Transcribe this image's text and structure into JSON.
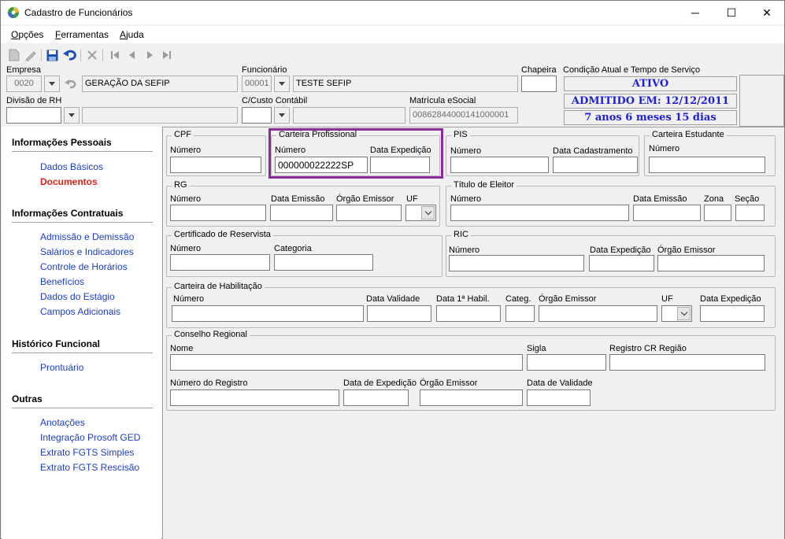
{
  "window": {
    "title": "Cadastro de Funcionários",
    "minimize": "─",
    "maximize": "☐",
    "close": "✕"
  },
  "menu": [
    {
      "label": "Opções",
      "mnemonic": "O",
      "rest": "pções"
    },
    {
      "label": "Ferramentas",
      "mnemonic": "F",
      "rest": "erramentas"
    },
    {
      "label": "Ajuda",
      "mnemonic": "A",
      "rest": "juda"
    }
  ],
  "toolbar": {
    "icons": [
      "new-icon",
      "edit-icon",
      "save-icon",
      "undo-icon",
      "delete-icon",
      "first-icon",
      "prev-icon",
      "next-icon",
      "last-icon"
    ]
  },
  "header": {
    "empresa_label": "Empresa",
    "empresa_code": "0020",
    "empresa_name": "GERAÇÃO DA SEFIP",
    "funcionario_label": "Funcionário",
    "funcionario_code": "00001",
    "funcionario_name": "TESTE SEFIP",
    "chapeira_label": "Chapeira",
    "chapeira_value": "",
    "condicao_label": "Condição Atual e Tempo de Serviço",
    "status_ativo": "ATIVO",
    "status_admitido": "ADMITIDO EM: 12/12/2011",
    "status_tempo": "7 anos 6 meses 15 dias",
    "divisao_label": "Divisão de RH",
    "divisao_value": "",
    "divisao_name": "",
    "custo_label": "C/Custo Contábil",
    "custo_value": "",
    "custo_name": "",
    "matricula_label": "Matrícula eSocial",
    "matricula_value": "00862844000141000001"
  },
  "sidebar": {
    "sections": [
      {
        "title": "Informações Pessoais",
        "items": [
          "Dados Básicos",
          "Documentos"
        ]
      },
      {
        "title": "Informações Contratuais",
        "items": [
          "Admissão e Demissão",
          "Salários e Indicadores",
          "Controle de Horários",
          "Benefícios",
          "Dados do Estágio",
          "Campos Adicionais"
        ]
      },
      {
        "title": "Histórico Funcional",
        "items": [
          "Prontuário"
        ]
      },
      {
        "title": "Outras",
        "items": [
          "Anotações",
          "Integração Prosoft GED",
          "Extrato FGTS Simples",
          "Extrato FGTS Rescisão"
        ]
      }
    ],
    "active_item": "Documentos"
  },
  "documents": {
    "cpf": {
      "title": "CPF",
      "numero_label": "Número",
      "numero": ""
    },
    "ctps": {
      "title": "Carteira Profissional",
      "numero_label": "Número",
      "numero": "000000022222SP",
      "data_label": "Data Expedição",
      "data": ""
    },
    "pis": {
      "title": "PIS",
      "numero_label": "Número",
      "numero": "",
      "data_label": "Data Cadastramento",
      "data": ""
    },
    "estudante": {
      "title": "Carteira Estudante",
      "numero_label": "Número",
      "numero": ""
    },
    "rg": {
      "title": "RG",
      "numero_label": "Número",
      "emissao_label": "Data Emissão",
      "orgao_label": "Órgão Emissor",
      "uf_label": "UF"
    },
    "titulo": {
      "title": "Título de Eleitor",
      "numero_label": "Número",
      "emissao_label": "Data Emissão",
      "zona_label": "Zona",
      "secao_label": "Seção"
    },
    "reservista": {
      "title": "Certificado de Reservista",
      "numero_label": "Número",
      "categoria_label": "Categoria"
    },
    "ric": {
      "title": "RIC",
      "numero_label": "Número",
      "expedicao_label": "Data Expedição",
      "orgao_label": "Órgão Emissor"
    },
    "cnh": {
      "title": "Carteira de Habilitação",
      "numero_label": "Número",
      "validade_label": "Data Validade",
      "habil_label": "Data 1ª Habil.",
      "categ_label": "Categ.",
      "orgao_label": "Órgão Emissor",
      "uf_label": "UF",
      "expedicao_label": "Data Expedição"
    },
    "conselho": {
      "title": "Conselho Regional",
      "nome_label": "Nome",
      "sigla_label": "Sigla",
      "regiao_label": "Registro CR Região",
      "registro_label": "Número do Registro",
      "expedicao_label": "Data de Expedição",
      "orgao_label": "Órgão Emissor",
      "validade_label": "Data de Validade"
    }
  }
}
